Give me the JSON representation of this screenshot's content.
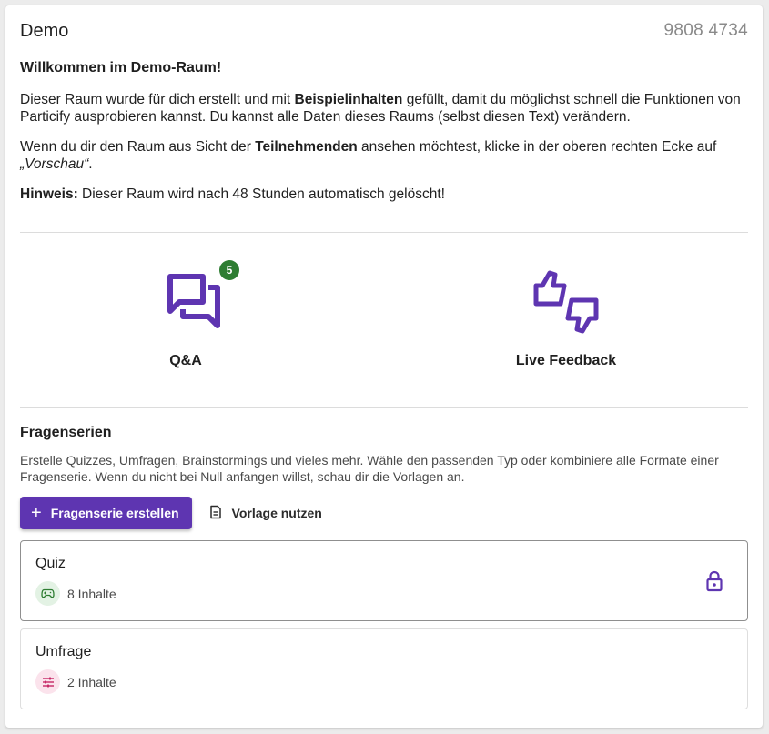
{
  "room": {
    "name": "Demo",
    "code": "9808 4734"
  },
  "welcome": {
    "title": "Willkommen im Demo-Raum!",
    "p1_a": "Dieser Raum wurde für dich erstellt und mit ",
    "p1_b": "Beispielinhalten",
    "p1_c": " gefüllt, damit du möglichst schnell die Funktionen von Particify ausprobieren kannst. Du kannst alle Daten dieses Raums (selbst diesen Text) verändern.",
    "p2_a": "Wenn du dir den Raum aus Sicht der ",
    "p2_b": "Teilnehmenden",
    "p2_c": " ansehen möchtest, klicke in der oberen rechten Ecke auf ",
    "p2_d": "„Vorschau“",
    "p2_e": ".",
    "p3_a": "Hinweis:",
    "p3_b": " Dieser Raum wird nach 48 Stunden automatisch gelöscht!"
  },
  "features": [
    {
      "label": "Q&A",
      "icon": "qa-chat-icon",
      "badge": "5"
    },
    {
      "label": "Live Feedback",
      "icon": "thumbs-feedback-icon"
    }
  ],
  "series_section": {
    "title": "Fragenserien",
    "description": "Erstelle Quizzes, Umfragen, Brainstormings und vieles mehr. Wähle den passenden Typ oder kombiniere alle Formate einer Fragenserie. Wenn du nicht bei Null anfangen willst, schau dir die Vorlagen an.",
    "create_label": "Fragenserie erstellen",
    "template_label": "Vorlage nutzen"
  },
  "series": [
    {
      "title": "Quiz",
      "count": "8 Inhalte",
      "icon": "gamepad-icon",
      "locked": true
    },
    {
      "title": "Umfrage",
      "count": "2 Inhalte",
      "icon": "sliders-icon",
      "locked": false
    }
  ],
  "colors": {
    "accent": "#5e35b1",
    "badge": "#2e7d32",
    "quiz_icon_bg": "#e3f2e4",
    "quiz_icon": "#2e7d32",
    "poll_icon_bg": "#fbe3ec",
    "poll_icon": "#c2185b"
  }
}
